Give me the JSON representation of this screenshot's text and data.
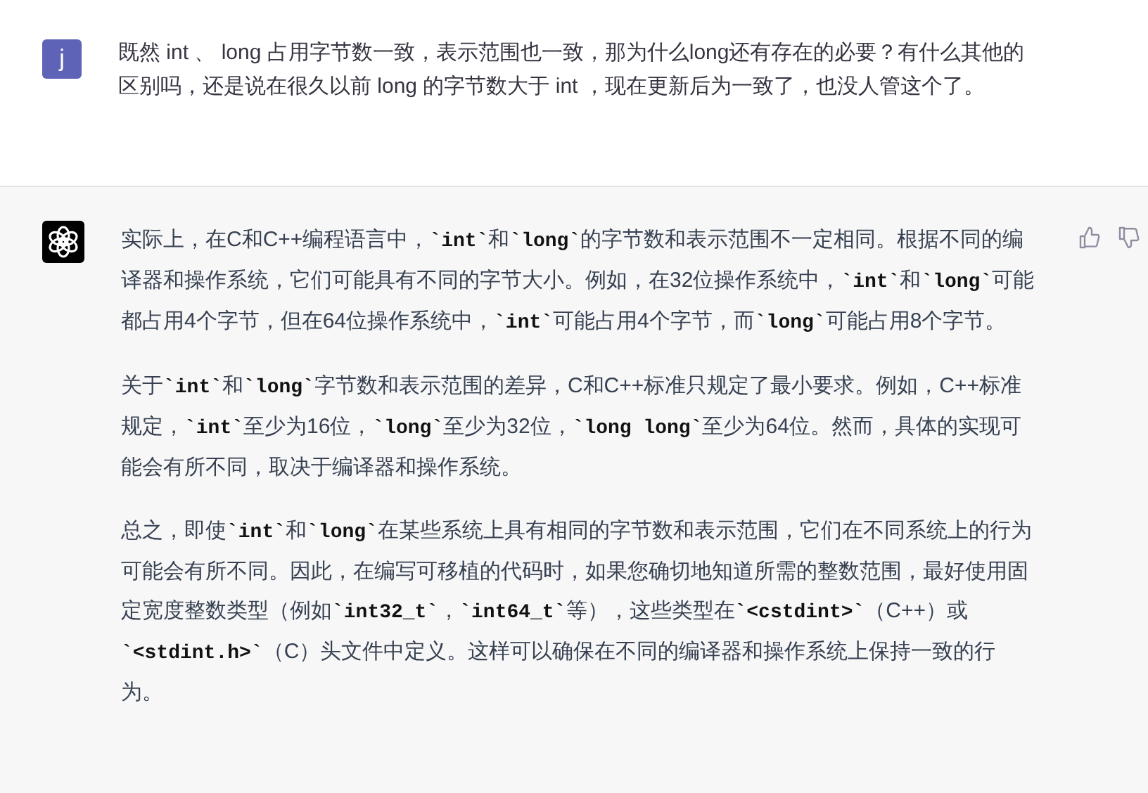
{
  "user_message": {
    "avatar_letter": "j",
    "text": "既然 int 、 long 占用字节数一致，表示范围也一致，那为什么long还有存在的必要？有什么其他的区别吗，还是说在很久以前 long 的字节数大于 int ，现在更新后为一致了，也没人管这个了。"
  },
  "assistant_message": {
    "paragraphs": [
      "实际上，在C和C++编程语言中，**`int`**和**`long`**的字节数和表示范围不一定相同。根据不同的编译器和操作系统，它们可能具有不同的字节大小。例如，在32位操作系统中，**`int`**和**`long`**可能都占用4个字节，但在64位操作系统中，**`int`**可能占用4个字节，而**`long`**可能占用8个字节。",
      "关于**`int`**和**`long`**字节数和表示范围的差异，C和C++标准只规定了最小要求。例如，C++标准规定，**`int`**至少为16位，**`long`**至少为32位，**`long long`**至少为64位。然而，具体的实现可能会有所不同，取决于编译器和操作系统。",
      "总之，即使**`int`**和**`long`**在某些系统上具有相同的字节数和表示范围，它们在不同系统上的行为可能会有所不同。因此，在编写可移植的代码时，如果您确切地知道所需的整数范围，最好使用固定宽度整数类型（例如**`int32_t`**，**`int64_t`**等），这些类型在**`<cstdint>`**（C++）或**`<stdint.h>`**（C）头文件中定义。这样可以确保在不同的编译器和操作系统上保持一致的行为。"
    ]
  }
}
